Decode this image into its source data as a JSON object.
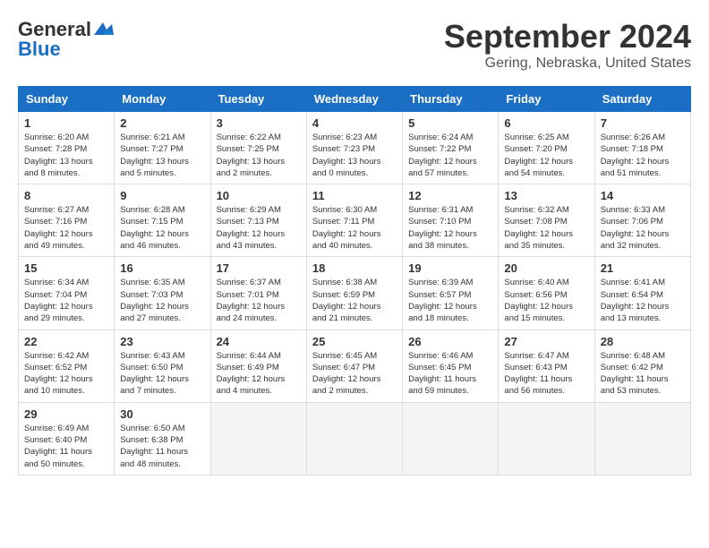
{
  "logo": {
    "line1": "General",
    "line2": "Blue",
    "bird_symbol": "▲"
  },
  "title": "September 2024",
  "location": "Gering, Nebraska, United States",
  "days_of_week": [
    "Sunday",
    "Monday",
    "Tuesday",
    "Wednesday",
    "Thursday",
    "Friday",
    "Saturday"
  ],
  "weeks": [
    [
      {
        "day": 1,
        "sunrise": "6:20 AM",
        "sunset": "7:28 PM",
        "daylight": "13 hours and 8 minutes."
      },
      {
        "day": 2,
        "sunrise": "6:21 AM",
        "sunset": "7:27 PM",
        "daylight": "13 hours and 5 minutes."
      },
      {
        "day": 3,
        "sunrise": "6:22 AM",
        "sunset": "7:25 PM",
        "daylight": "13 hours and 2 minutes."
      },
      {
        "day": 4,
        "sunrise": "6:23 AM",
        "sunset": "7:23 PM",
        "daylight": "13 hours and 0 minutes."
      },
      {
        "day": 5,
        "sunrise": "6:24 AM",
        "sunset": "7:22 PM",
        "daylight": "12 hours and 57 minutes."
      },
      {
        "day": 6,
        "sunrise": "6:25 AM",
        "sunset": "7:20 PM",
        "daylight": "12 hours and 54 minutes."
      },
      {
        "day": 7,
        "sunrise": "6:26 AM",
        "sunset": "7:18 PM",
        "daylight": "12 hours and 51 minutes."
      }
    ],
    [
      {
        "day": 8,
        "sunrise": "6:27 AM",
        "sunset": "7:16 PM",
        "daylight": "12 hours and 49 minutes."
      },
      {
        "day": 9,
        "sunrise": "6:28 AM",
        "sunset": "7:15 PM",
        "daylight": "12 hours and 46 minutes."
      },
      {
        "day": 10,
        "sunrise": "6:29 AM",
        "sunset": "7:13 PM",
        "daylight": "12 hours and 43 minutes."
      },
      {
        "day": 11,
        "sunrise": "6:30 AM",
        "sunset": "7:11 PM",
        "daylight": "12 hours and 40 minutes."
      },
      {
        "day": 12,
        "sunrise": "6:31 AM",
        "sunset": "7:10 PM",
        "daylight": "12 hours and 38 minutes."
      },
      {
        "day": 13,
        "sunrise": "6:32 AM",
        "sunset": "7:08 PM",
        "daylight": "12 hours and 35 minutes."
      },
      {
        "day": 14,
        "sunrise": "6:33 AM",
        "sunset": "7:06 PM",
        "daylight": "12 hours and 32 minutes."
      }
    ],
    [
      {
        "day": 15,
        "sunrise": "6:34 AM",
        "sunset": "7:04 PM",
        "daylight": "12 hours and 29 minutes."
      },
      {
        "day": 16,
        "sunrise": "6:35 AM",
        "sunset": "7:03 PM",
        "daylight": "12 hours and 27 minutes."
      },
      {
        "day": 17,
        "sunrise": "6:37 AM",
        "sunset": "7:01 PM",
        "daylight": "12 hours and 24 minutes."
      },
      {
        "day": 18,
        "sunrise": "6:38 AM",
        "sunset": "6:59 PM",
        "daylight": "12 hours and 21 minutes."
      },
      {
        "day": 19,
        "sunrise": "6:39 AM",
        "sunset": "6:57 PM",
        "daylight": "12 hours and 18 minutes."
      },
      {
        "day": 20,
        "sunrise": "6:40 AM",
        "sunset": "6:56 PM",
        "daylight": "12 hours and 15 minutes."
      },
      {
        "day": 21,
        "sunrise": "6:41 AM",
        "sunset": "6:54 PM",
        "daylight": "12 hours and 13 minutes."
      }
    ],
    [
      {
        "day": 22,
        "sunrise": "6:42 AM",
        "sunset": "6:52 PM",
        "daylight": "12 hours and 10 minutes."
      },
      {
        "day": 23,
        "sunrise": "6:43 AM",
        "sunset": "6:50 PM",
        "daylight": "12 hours and 7 minutes."
      },
      {
        "day": 24,
        "sunrise": "6:44 AM",
        "sunset": "6:49 PM",
        "daylight": "12 hours and 4 minutes."
      },
      {
        "day": 25,
        "sunrise": "6:45 AM",
        "sunset": "6:47 PM",
        "daylight": "12 hours and 2 minutes."
      },
      {
        "day": 26,
        "sunrise": "6:46 AM",
        "sunset": "6:45 PM",
        "daylight": "11 hours and 59 minutes."
      },
      {
        "day": 27,
        "sunrise": "6:47 AM",
        "sunset": "6:43 PM",
        "daylight": "11 hours and 56 minutes."
      },
      {
        "day": 28,
        "sunrise": "6:48 AM",
        "sunset": "6:42 PM",
        "daylight": "11 hours and 53 minutes."
      }
    ],
    [
      {
        "day": 29,
        "sunrise": "6:49 AM",
        "sunset": "6:40 PM",
        "daylight": "11 hours and 50 minutes."
      },
      {
        "day": 30,
        "sunrise": "6:50 AM",
        "sunset": "6:38 PM",
        "daylight": "11 hours and 48 minutes."
      },
      null,
      null,
      null,
      null,
      null
    ]
  ]
}
